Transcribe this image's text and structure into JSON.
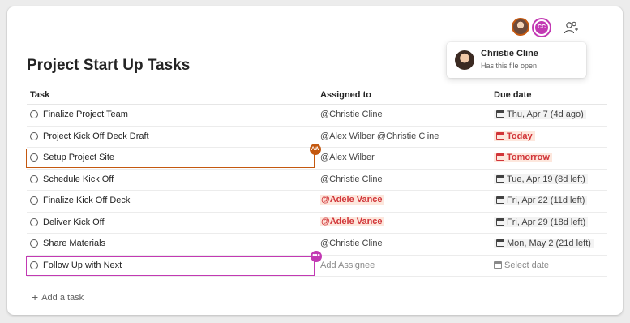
{
  "page": {
    "title": "Project Start Up Tasks"
  },
  "presence": {
    "avatar_badge_initials": "CC",
    "card": {
      "name": "Christie Cline",
      "status": "Has this file open"
    }
  },
  "columns": {
    "task": "Task",
    "assigned": "Assigned to",
    "due": "Due date"
  },
  "rows": [
    {
      "task": "Finalize Project Team",
      "assigned": "@Christie Cline",
      "due": "Thu, Apr 7 (4d ago)"
    },
    {
      "task": "Project Kick Off Deck Draft",
      "assigned": "@Alex Wilber @Christie Cline",
      "due": "Today"
    },
    {
      "task": "Setup Project Site",
      "assigned": "@Alex Wilber",
      "due": "Tomorrow",
      "badge": "AW"
    },
    {
      "task": "Schedule Kick Off",
      "assigned": "@Christie Cline",
      "due": "Tue, Apr 19 (8d left)"
    },
    {
      "task": "Finalize Kick Off Deck",
      "assigned": "@Adele Vance",
      "due": "Fri, Apr 22 (11d left)"
    },
    {
      "task": "Deliver Kick Off",
      "assigned": "@Adele Vance",
      "due": "Fri, Apr 29 (18d left)"
    },
    {
      "task": "Share Materials",
      "assigned": "@Christie Cline",
      "due": "Mon, May 2 (21d left)"
    },
    {
      "task": "Follow Up with Next",
      "assigned": "Add Assignee",
      "due": "Select date",
      "badge": "•••"
    }
  ],
  "add_task": {
    "label": "Add a task"
  },
  "colors": {
    "orange": "#c4580f",
    "magenta": "#c239b3",
    "red": "#d13438"
  }
}
